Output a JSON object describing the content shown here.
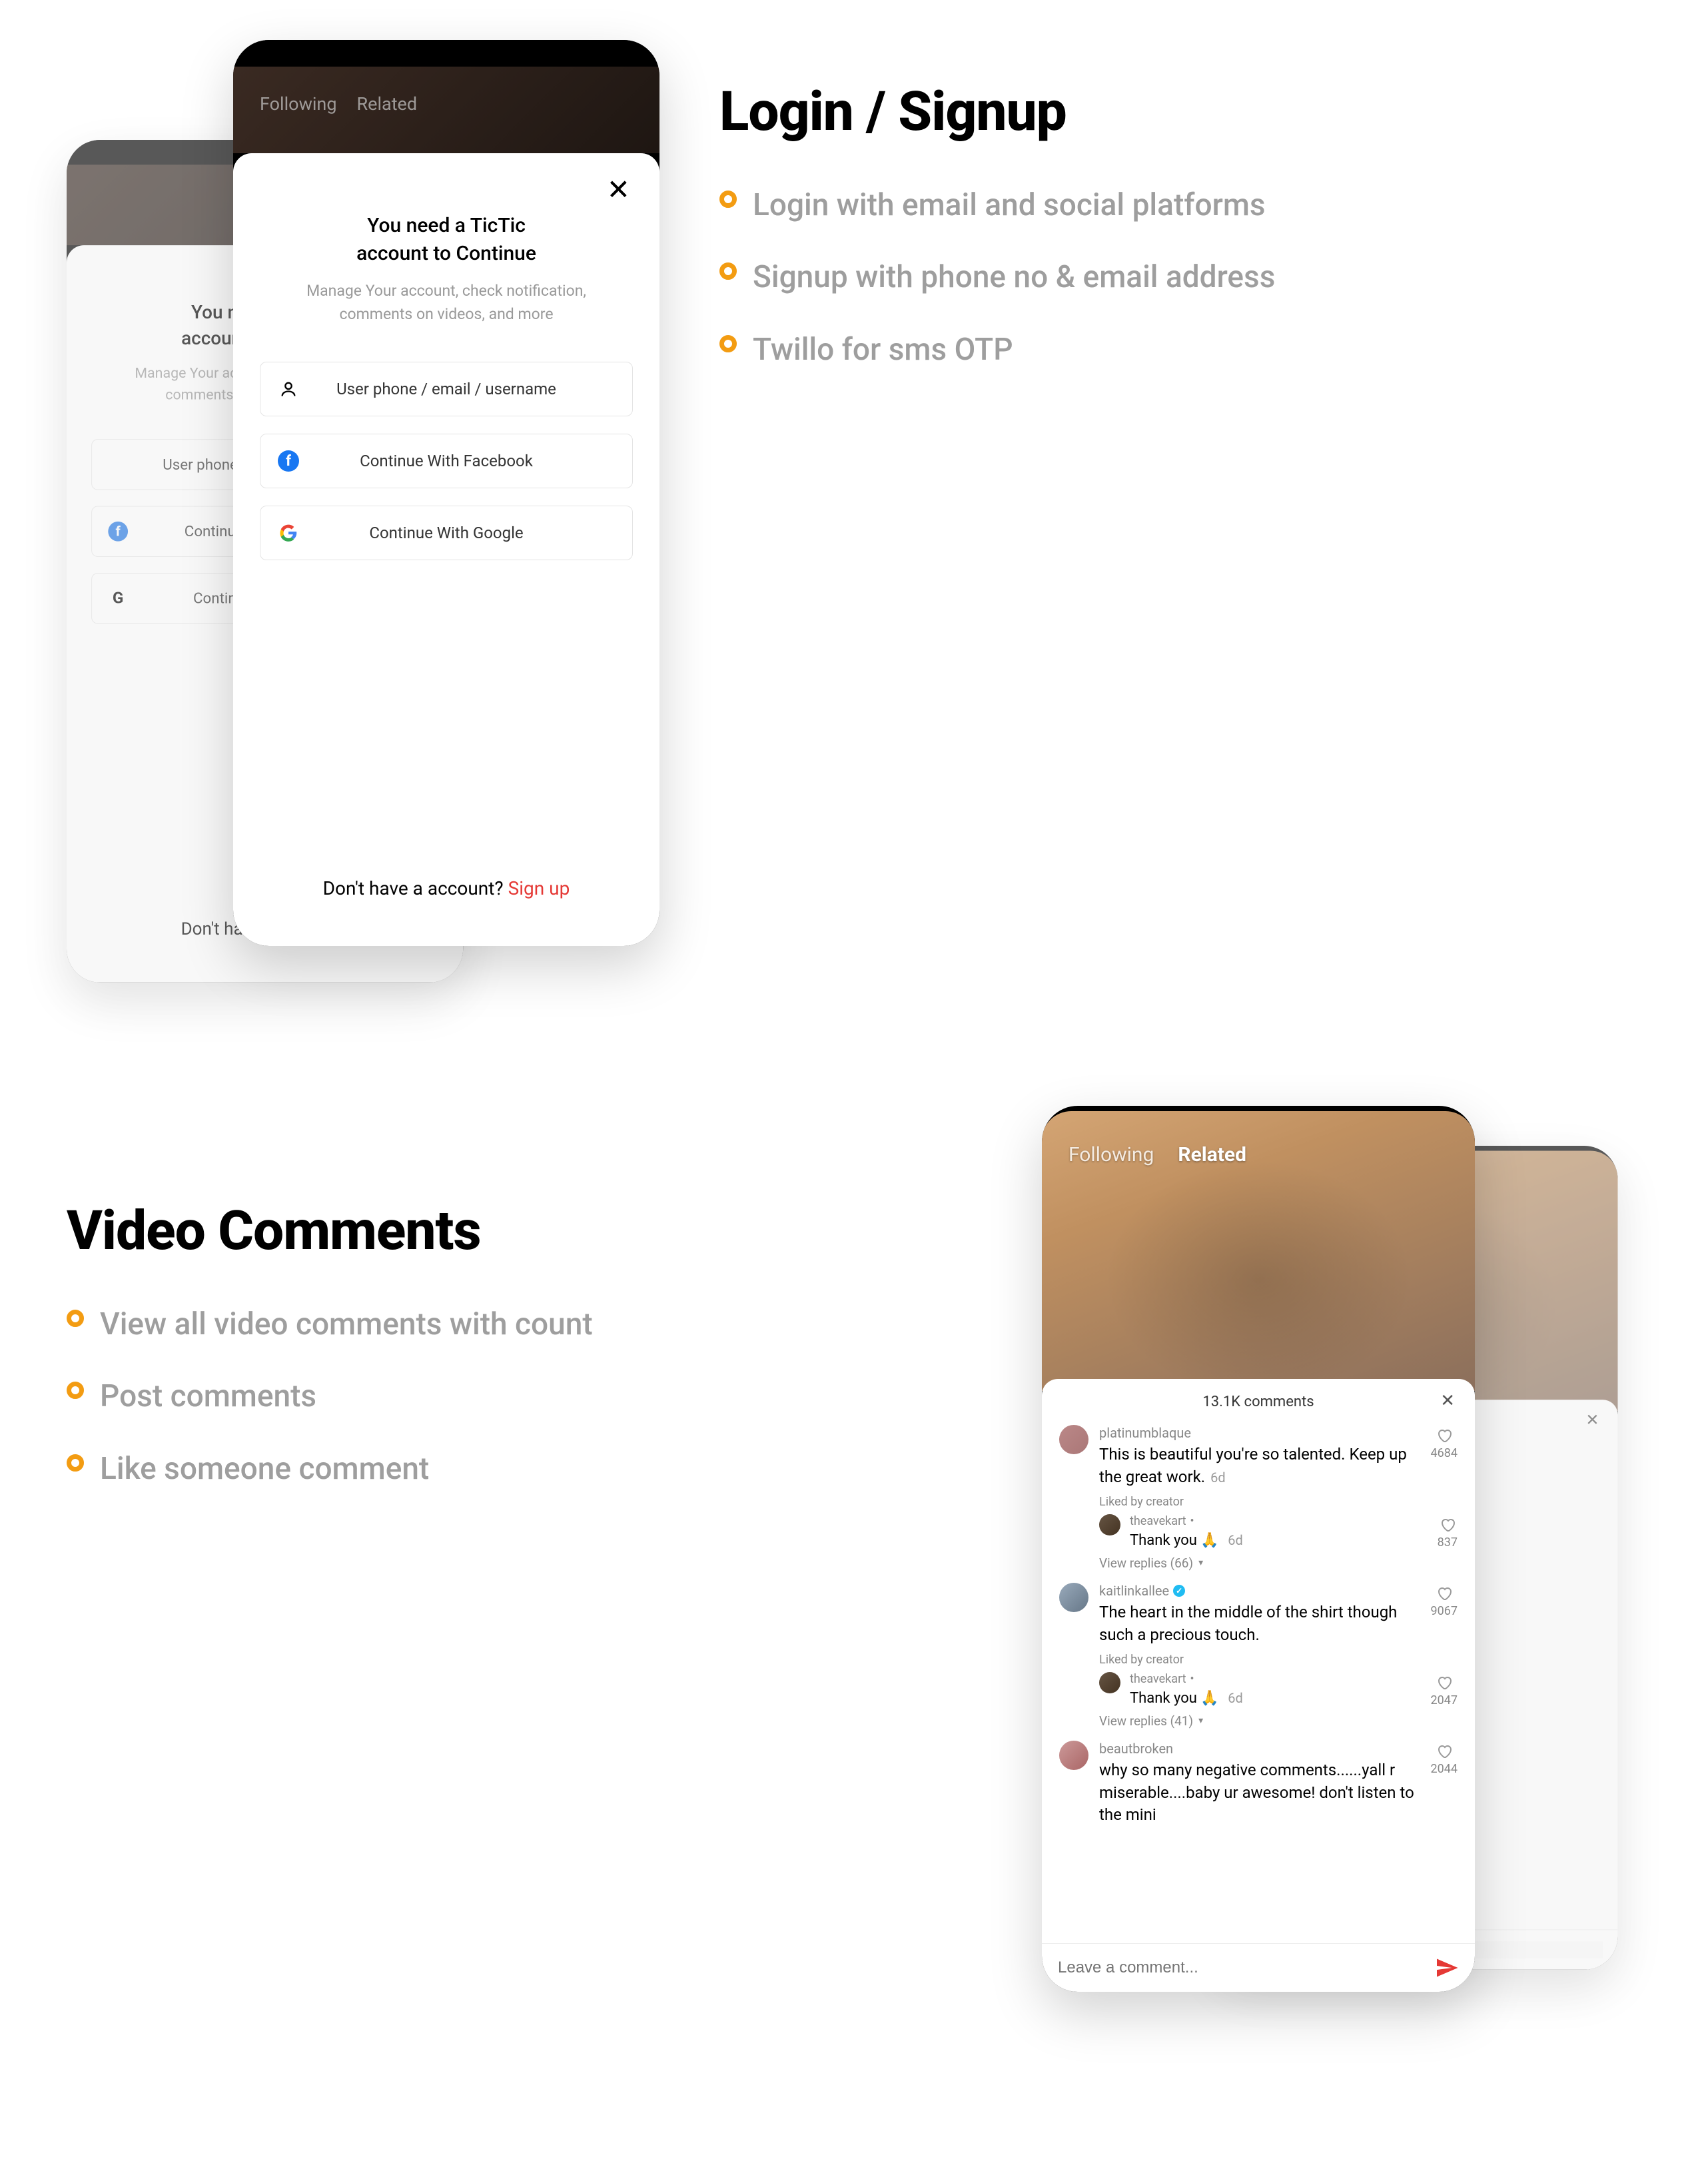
{
  "section1": {
    "title": "Login / Signup",
    "features": [
      "Login with email and social platforms",
      "Signup with phone no & email address",
      "Twillo for sms OTP"
    ],
    "phone": {
      "tabs": {
        "following": "Following",
        "related": "Related"
      },
      "sheet": {
        "title_line1": "You need a TicTic",
        "title_line2": "account to Continue",
        "subtitle": "Manage Your account, check notification, comments on videos, and more",
        "btn_phone": "User phone / email / username",
        "btn_facebook": "Continue With Facebook",
        "btn_google": "Continue With Google",
        "signup_prompt": "Don't have a account? ",
        "signup_link": "Sign up"
      }
    }
  },
  "section2": {
    "title": "Video Comments",
    "features": [
      "View all video comments with count",
      "Post comments",
      "Like someone comment"
    ],
    "phone": {
      "tabs": {
        "following": "Following",
        "related": "Related"
      },
      "header": "13.1K comments",
      "comments": [
        {
          "user": "platinumblaque",
          "text": "This is beautiful you're so talented. Keep up the great work.",
          "time": "6d",
          "likes": "4684",
          "liked_by_creator": "Liked by creator",
          "reply": {
            "user": "theavekart",
            "dot": "•",
            "text": "Thank you 🙏",
            "time": "6d",
            "likes": "837"
          },
          "view_replies": "View replies (66)"
        },
        {
          "user": "kaitlinkallee",
          "verified": true,
          "text": "The heart in the middle of the shirt though such a precious touch.",
          "likes": "9067",
          "liked_by_creator": "Liked by creator",
          "reply": {
            "user": "theavekart",
            "dot": "•",
            "text": "Thank you 🙏",
            "time": "6d",
            "likes": "2047"
          },
          "view_replies": "View replies (41)"
        },
        {
          "user": "beautbroken",
          "text": "why so many negative comments......yall r miserable....baby ur awesome! don't listen to the mini",
          "likes": "2044"
        }
      ],
      "input_placeholder": "Leave a comment..."
    }
  }
}
